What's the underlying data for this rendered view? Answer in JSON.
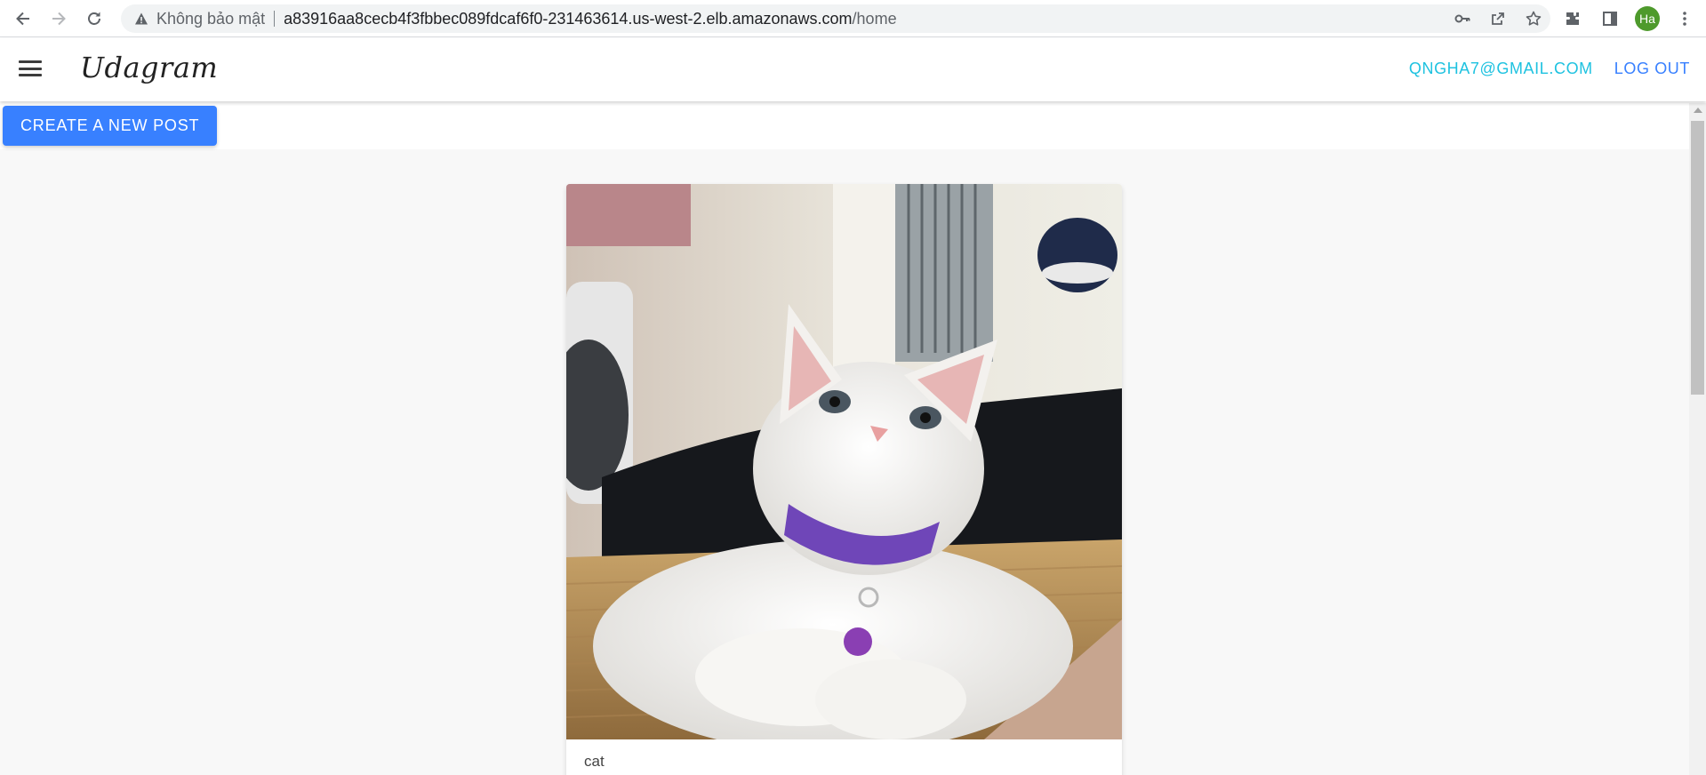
{
  "browser": {
    "security_label": "Không bảo mật",
    "url_host": "a83916aa8cecb4f3fbbec089fdcaf6f0-231463614.us-west-2.elb.amazonaws.com",
    "url_path": "/home",
    "profile_initials": "Ha",
    "icons": [
      "back-icon",
      "forward-icon",
      "reload-icon",
      "warning-icon",
      "key-icon",
      "share-icon",
      "star-icon",
      "extensions-icon",
      "side-panel-icon",
      "more-icon"
    ]
  },
  "header": {
    "brand": "Udagram",
    "user_email": "QNGHA7@GMAIL.COM",
    "logout_label": "LOG OUT"
  },
  "toolbar": {
    "create_label": "CREATE A NEW POST"
  },
  "feed": {
    "posts": [
      {
        "caption": "cat",
        "image_subject": "white kitten with purple collar and bell"
      }
    ]
  },
  "colors": {
    "primary": "#3880ff",
    "secondary": "#1ec2e0",
    "page_bg": "#f8f8f8"
  }
}
